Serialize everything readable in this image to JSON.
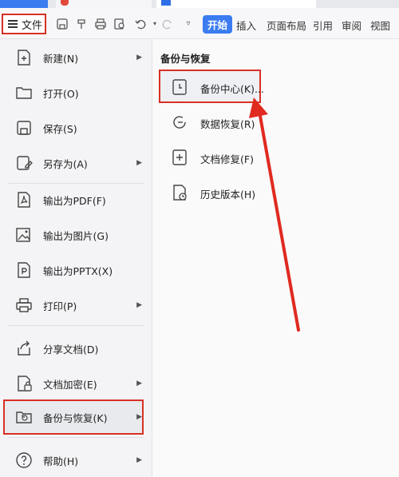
{
  "toolbar": {
    "file_label": "文件",
    "tabs": [
      "开始",
      "插入",
      "页面布局",
      "引用",
      "审阅",
      "视图"
    ]
  },
  "left_menu": {
    "items": [
      {
        "label": "新建(N)",
        "icon": "new-doc-icon",
        "has_arrow": true
      },
      {
        "label": "打开(O)",
        "icon": "folder-icon",
        "has_arrow": false
      },
      {
        "label": "保存(S)",
        "icon": "save-icon",
        "has_arrow": false
      },
      {
        "label": "另存为(A)",
        "icon": "save-as-icon",
        "has_arrow": true
      },
      {
        "label": "输出为PDF(F)",
        "icon": "pdf-icon",
        "has_arrow": false
      },
      {
        "label": "输出为图片(G)",
        "icon": "image-icon",
        "has_arrow": false
      },
      {
        "label": "输出为PPTX(X)",
        "icon": "pptx-icon",
        "has_arrow": false
      },
      {
        "label": "打印(P)",
        "icon": "print-icon",
        "has_arrow": true
      },
      {
        "label": "分享文档(D)",
        "icon": "share-icon",
        "has_arrow": false
      },
      {
        "label": "文档加密(E)",
        "icon": "lock-icon",
        "has_arrow": true
      },
      {
        "label": "备份与恢复(K)",
        "icon": "backup-icon",
        "has_arrow": true
      },
      {
        "label": "帮助(H)",
        "icon": "help-icon",
        "has_arrow": true
      }
    ]
  },
  "submenu": {
    "title": "备份与恢复",
    "items": [
      {
        "label": "备份中心(K)...",
        "icon": "backup-center-icon"
      },
      {
        "label": "数据恢复(R)",
        "icon": "data-recovery-icon"
      },
      {
        "label": "文档修复(F)",
        "icon": "doc-repair-icon"
      },
      {
        "label": "历史版本(H)",
        "icon": "history-version-icon"
      }
    ]
  },
  "colors": {
    "highlight": "#d93025",
    "accent": "#3b7cf0"
  }
}
